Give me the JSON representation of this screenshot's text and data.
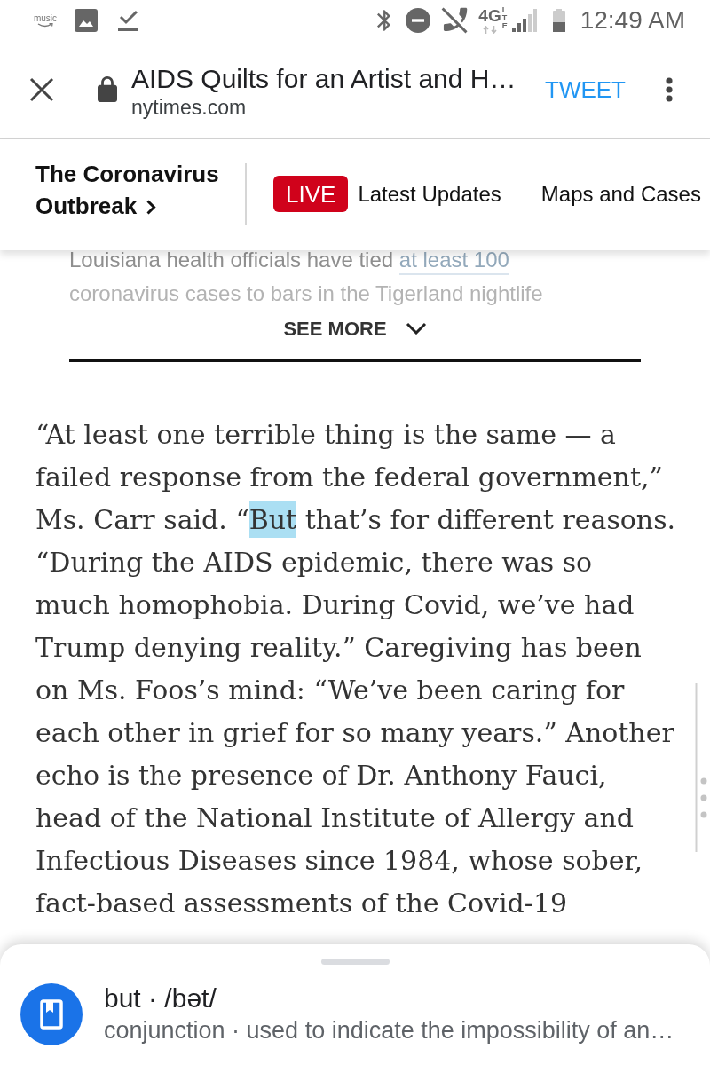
{
  "status_bar": {
    "music_label": "music",
    "network": "4G",
    "network_detail": "LTE",
    "time": "12:49 AM"
  },
  "toolbar": {
    "title": "AIDS Quilts for an Artist and H…",
    "domain": "nytimes.com",
    "action": "TWEET"
  },
  "section_bar": {
    "title": "The Coronavirus Outbreak",
    "live_badge": "LIVE",
    "links": [
      "Latest Updates",
      "Maps and Cases"
    ]
  },
  "teaser": {
    "text": "Louisiana health officials have tied",
    "link": "at least 100",
    "continuation": "coronavirus cases to bars in the Tigerland nightlife",
    "button": "SEE MORE"
  },
  "article": {
    "runs": [
      {
        "text": "“At least one terrible thing is the same — a\nfailed response from the federal government,”\nMs. Carr said. “",
        "selected": false
      },
      {
        "text": "But",
        "selected": true
      },
      {
        "text": " that’s for different reasons.\n“During the AIDS epidemic, there was so\nmuch homophobia. During Covid, we’ve had\nTrump denying reality.” Caregiving has been\non Ms. Foos’s mind: “We’ve been caring for\neach other in grief for so many years.” Another\necho is the presence of Dr. Anthony Fauci,\nhead of the National Institute of Allergy and\nInfectious Diseases since 1984, whose sober,\nfact-based assessments of the Covid-19",
        "selected": false
      }
    ]
  },
  "definition_sheet": {
    "headword": "but · /bət/",
    "definition": "conjunction · used to indicate the impossibility of an…"
  }
}
